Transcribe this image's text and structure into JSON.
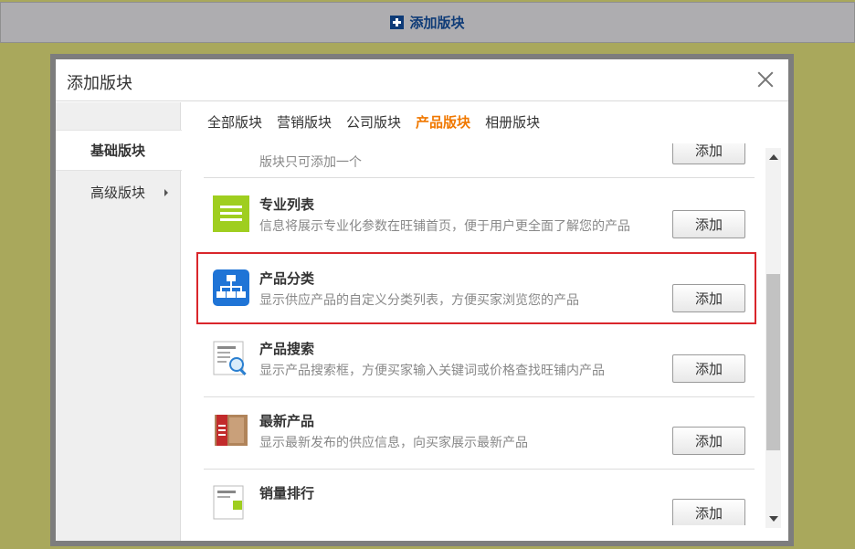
{
  "top_bar": {
    "add_label": "添加版块"
  },
  "dialog": {
    "title": "添加版块",
    "sidebar": [
      {
        "label": "基础版块"
      },
      {
        "label": "高级版块"
      }
    ],
    "tabs": [
      {
        "label": "全部版块"
      },
      {
        "label": "营销版块"
      },
      {
        "label": "公司版块"
      },
      {
        "label": "产品版块",
        "active": true
      },
      {
        "label": "相册版块"
      }
    ],
    "items": [
      {
        "name": "",
        "desc": "版块只可添加一个",
        "button": "添加",
        "icon": "partial-icon"
      },
      {
        "name": "专业列表",
        "desc": "信息将展示专业化参数在旺铺首页，便于用户更全面了解您的产品",
        "button": "添加",
        "icon": "list-icon"
      },
      {
        "name": "产品分类",
        "desc": "显示供应产品的自定义分类列表，方便买家浏览您的产品",
        "button": "添加",
        "icon": "category-tree-icon",
        "highlighted": true
      },
      {
        "name": "产品搜索",
        "desc": "显示产品搜索框，方便买家输入关键词或价格查找旺铺内产品",
        "button": "添加",
        "icon": "search-page-icon"
      },
      {
        "name": "最新产品",
        "desc": "显示最新发布的供应信息，向买家展示最新产品",
        "button": "添加",
        "icon": "new-product-icon"
      },
      {
        "name": "销量排行",
        "desc": "",
        "button": "添加",
        "icon": "sales-rank-icon"
      }
    ]
  },
  "colors": {
    "background": "#a9a85c",
    "active_tab": "#f07800",
    "highlight_border": "#d9262b",
    "top_bar_text": "#0e3b77"
  }
}
